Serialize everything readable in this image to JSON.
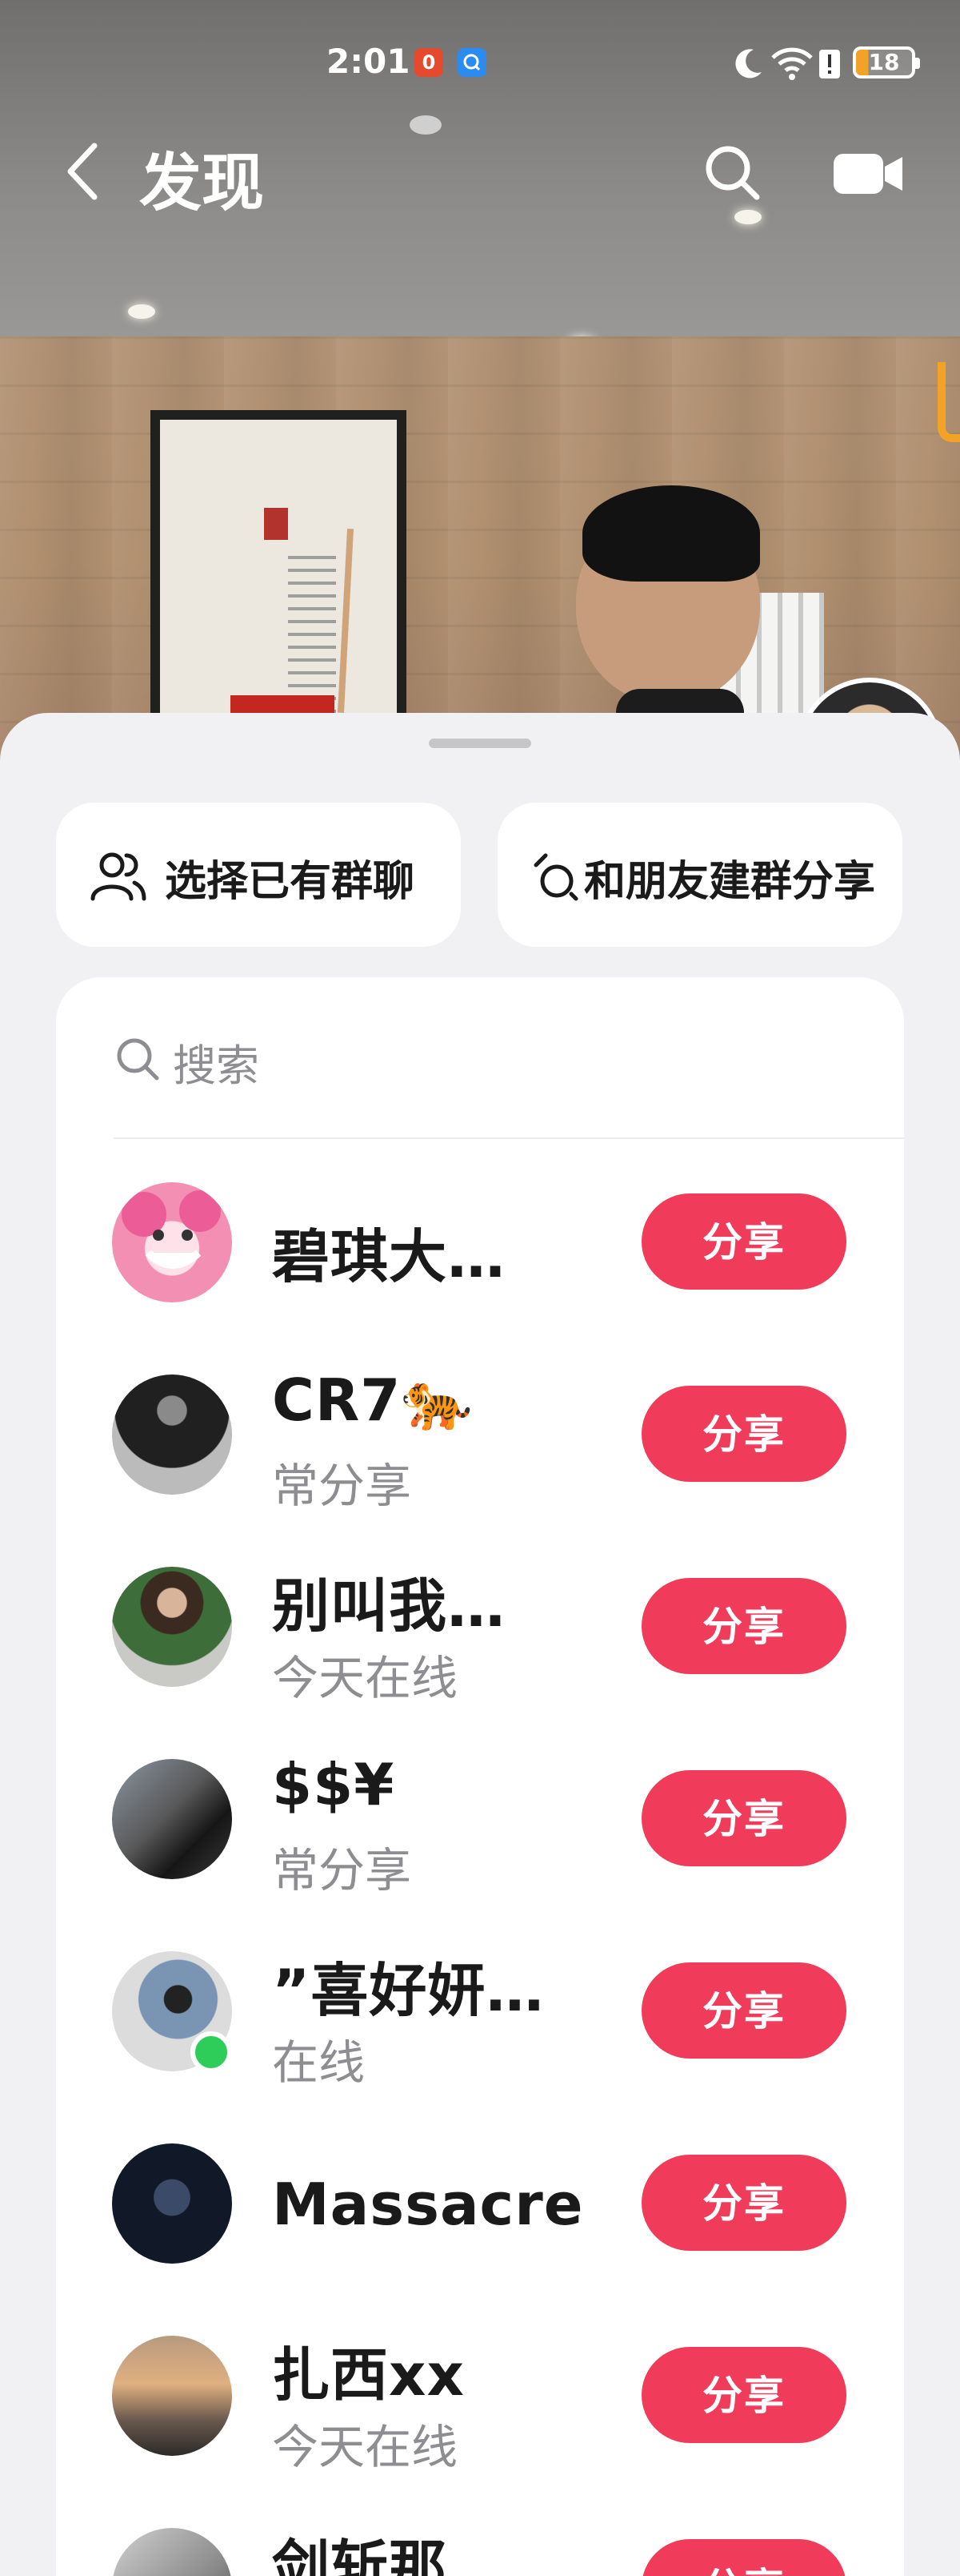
{
  "status_bar": {
    "time": "2:01",
    "notif_1": "0",
    "battery": "18"
  },
  "header": {
    "title": "发现"
  },
  "actions": {
    "existing_group": "选择已有群聊",
    "create_group": "和朋友建群分享"
  },
  "search": {
    "placeholder": "搜索"
  },
  "share_label": "分享",
  "contacts": [
    {
      "name": "碧琪大…",
      "status": "",
      "online": false
    },
    {
      "name": "CR7🐅",
      "status": "常分享",
      "online": false
    },
    {
      "name": "别叫我…",
      "status": "今天在线",
      "online": false
    },
    {
      "name": "$$¥",
      "status": "常分享",
      "online": false
    },
    {
      "name": "”喜好妍…",
      "status": "在线",
      "online": true
    },
    {
      "name": "Massacre",
      "status": "",
      "online": false
    },
    {
      "name": "扎西xx",
      "status": "今天在线",
      "online": false
    },
    {
      "name": "剑斩那",
      "status": "",
      "online": false
    }
  ],
  "colors": {
    "share_button": "#f03b5b",
    "online_dot": "#2ecc59",
    "sheet_bg": "#f1f1f3",
    "secondary_text": "#8d8d92"
  },
  "icons": {
    "back": "chevron-left-icon",
    "search": "search-icon",
    "camera": "video-camera-icon",
    "group": "group-people-icon",
    "create_group": "create-group-icon"
  }
}
